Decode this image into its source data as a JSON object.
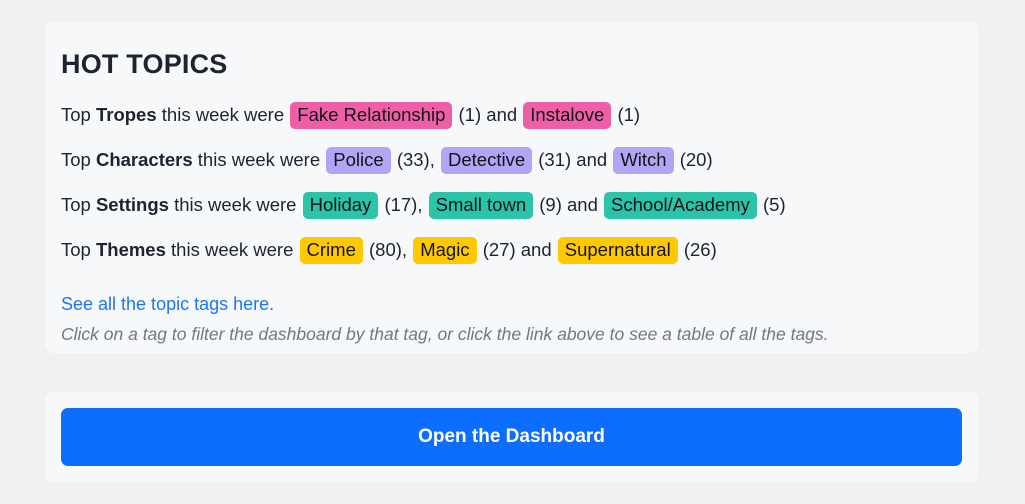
{
  "card": {
    "heading": "HOT TOPICS",
    "rows": [
      {
        "name": "tropes",
        "prefix": "Top ",
        "category": "Tropes",
        "middle": " this week were ",
        "tag_class": "tag-trope",
        "items": [
          {
            "label": "Fake Relationship",
            "count": "(1)",
            "sep": " and "
          },
          {
            "label": "Instalove",
            "count": "(1)",
            "sep": ""
          }
        ]
      },
      {
        "name": "characters",
        "prefix": "Top ",
        "category": "Characters",
        "middle": " this week were ",
        "tag_class": "tag-character",
        "items": [
          {
            "label": "Police",
            "count": "(33),",
            "sep": " "
          },
          {
            "label": "Detective",
            "count": "(31)",
            "sep": " and "
          },
          {
            "label": "Witch",
            "count": "(20)",
            "sep": ""
          }
        ]
      },
      {
        "name": "settings",
        "prefix": "Top ",
        "category": "Settings",
        "middle": " this week were ",
        "tag_class": "tag-setting",
        "items": [
          {
            "label": "Holiday",
            "count": "(17),",
            "sep": " "
          },
          {
            "label": "Small town",
            "count": "(9)",
            "sep": " and "
          },
          {
            "label": "School/Academy",
            "count": "(5)",
            "sep": ""
          }
        ]
      },
      {
        "name": "themes",
        "prefix": "Top ",
        "category": "Themes",
        "middle": " this week were ",
        "tag_class": "tag-theme",
        "items": [
          {
            "label": "Crime",
            "count": "(80),",
            "sep": " "
          },
          {
            "label": "Magic",
            "count": "(27)",
            "sep": " and "
          },
          {
            "label": "Supernatural",
            "count": "(26)",
            "sep": ""
          }
        ]
      }
    ],
    "link_text": "See all the topic tags here.",
    "caption": "Click on a tag to filter the dashboard by that tag, or click the link above to see a table of all the tags."
  },
  "dashboard": {
    "button_label": "Open the Dashboard"
  },
  "colors": {
    "page_background": "#f1f1f1",
    "card_background": "#f7f8fa",
    "trope_tag": "#ee5fa7",
    "character_tag": "#b3a5f5",
    "setting_tag": "#2bc4a8",
    "theme_tag": "#ffc800",
    "link": "#1a76f2",
    "button": "#0d6efd",
    "caption_text": "#71787f",
    "body_text": "#1b2430"
  }
}
